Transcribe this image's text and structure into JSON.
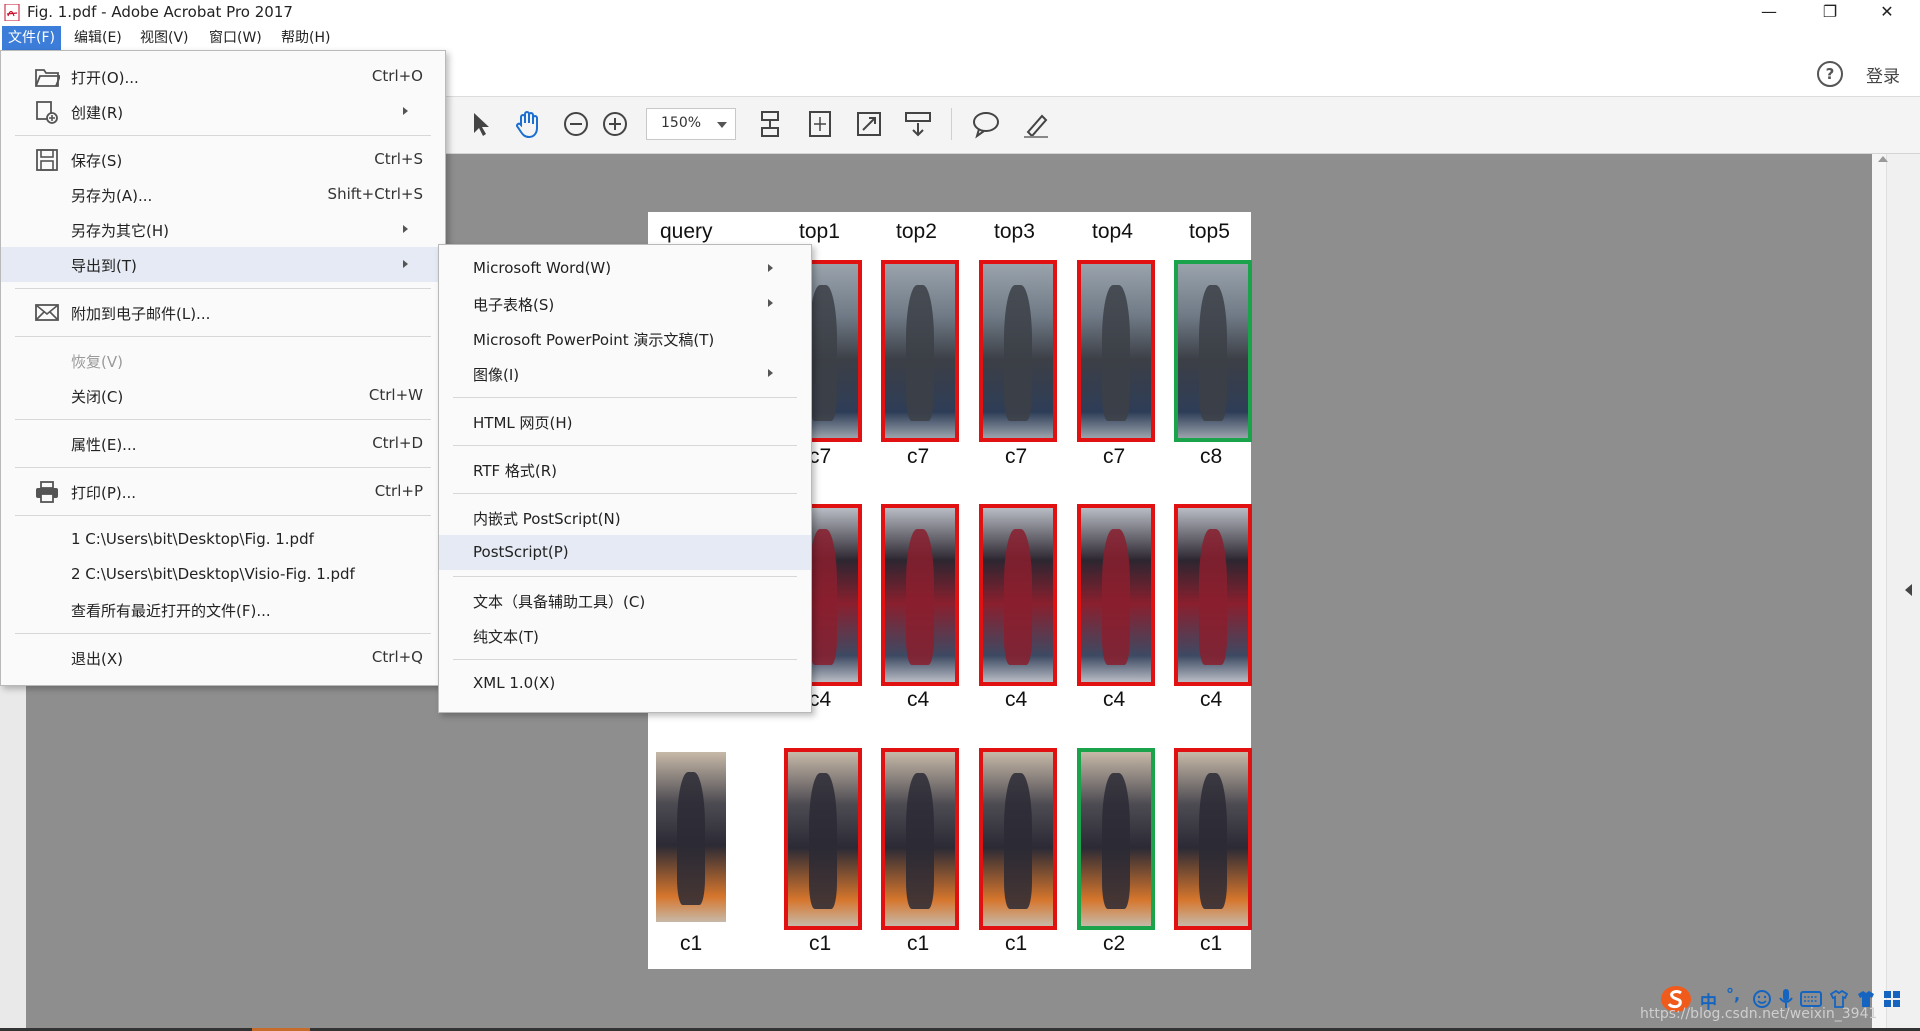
{
  "window": {
    "title": "Fig. 1.pdf - Adobe Acrobat Pro 2017",
    "minimize": "—",
    "restore": "❐",
    "close": "✕"
  },
  "menubar": {
    "items": [
      "文件(F)",
      "编辑(E)",
      "视图(V)",
      "窗口(W)",
      "帮助(H)"
    ]
  },
  "appbar": {
    "help": "?",
    "login": "登录"
  },
  "toolbar": {
    "zoom": "150%"
  },
  "file_menu": {
    "items": [
      {
        "label": "打开(O)...",
        "shortcut": "Ctrl+O"
      },
      {
        "label": "创建(R)",
        "shortcut": ""
      },
      {
        "label": "保存(S)",
        "shortcut": "Ctrl+S"
      },
      {
        "label": "另存为(A)...",
        "shortcut": "Shift+Ctrl+S"
      },
      {
        "label": "另存为其它(H)",
        "shortcut": ""
      },
      {
        "label": "导出到(T)",
        "shortcut": ""
      },
      {
        "label": "附加到电子邮件(L)...",
        "shortcut": ""
      },
      {
        "label": "恢复(V)",
        "shortcut": ""
      },
      {
        "label": "关闭(C)",
        "shortcut": "Ctrl+W"
      },
      {
        "label": "属性(E)...",
        "shortcut": "Ctrl+D"
      },
      {
        "label": "打印(P)...",
        "shortcut": "Ctrl+P"
      },
      {
        "label": "1 C:\\Users\\bit\\Desktop\\Fig. 1.pdf",
        "shortcut": ""
      },
      {
        "label": "2 C:\\Users\\bit\\Desktop\\Visio-Fig. 1.pdf",
        "shortcut": ""
      },
      {
        "label": "查看所有最近打开的文件(F)...",
        "shortcut": ""
      },
      {
        "label": "退出(X)",
        "shortcut": "Ctrl+Q"
      }
    ]
  },
  "export_menu": {
    "items": [
      "Microsoft Word(W)",
      "电子表格(S)",
      "Microsoft PowerPoint 演示文稿(T)",
      "图像(I)",
      "HTML 网页(H)",
      "RTF 格式(R)",
      "内嵌式 PostScript(N)",
      "PostScript(P)",
      "文本（具备辅助工具）(C)",
      "纯文本(T)",
      "XML 1.0(X)"
    ]
  },
  "figure": {
    "headers": [
      "query",
      "top1",
      "top2",
      "top3",
      "top4",
      "top5"
    ],
    "rows": [
      {
        "labels": [
          "",
          "c7",
          "c7",
          "c7",
          "c7",
          "c8"
        ],
        "match": [
          "none",
          "wrong",
          "wrong",
          "wrong",
          "wrong",
          "correct"
        ]
      },
      {
        "labels": [
          "",
          "c4",
          "c4",
          "c4",
          "c4",
          "c4"
        ],
        "match": [
          "none",
          "wrong",
          "wrong",
          "wrong",
          "wrong",
          "wrong"
        ]
      },
      {
        "labels": [
          "c1",
          "c1",
          "c1",
          "c1",
          "c2",
          "c1"
        ],
        "match": [
          "none",
          "wrong",
          "wrong",
          "wrong",
          "correct",
          "wrong"
        ]
      }
    ],
    "colors": {
      "wrong": "#e11111",
      "correct": "#1aa34a"
    }
  },
  "ime": {
    "label": "中",
    "punct": "°,"
  },
  "watermark": "https://blog.csdn.net/weixin_3941"
}
